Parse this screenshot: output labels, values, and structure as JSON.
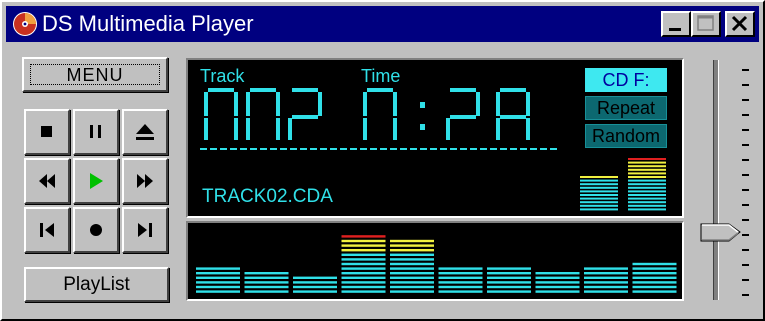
{
  "window": {
    "title": "DS Multimedia Player"
  },
  "controls": {
    "menu_label": "MENU",
    "playlist_label": "PlayList"
  },
  "display": {
    "track_label": "Track",
    "time_label": "Time",
    "track_number": "002",
    "time_minutes": "0",
    "time_seconds": "28",
    "time_colon": ":",
    "filename": "TRACK02.CDA"
  },
  "tags": {
    "source": "CD F:",
    "repeat": "Repeat",
    "random": "Random"
  },
  "state": {
    "source_active": true,
    "repeat_active": false,
    "random_active": false,
    "playing": true
  },
  "colors": {
    "lcd_cyan": "#30e0e8",
    "level_yellow": "#f0f040",
    "level_red": "#e02020",
    "play_green": "#00c000",
    "titlebar": "#000080"
  },
  "vu_meter": {
    "left_level": 0.63,
    "right_level": 0.94
  },
  "equalizer": {
    "band_levels": [
      6,
      5,
      4,
      13,
      12,
      6,
      6,
      5,
      6,
      7
    ],
    "max_level": 14
  },
  "volume": {
    "level": 0.27
  }
}
